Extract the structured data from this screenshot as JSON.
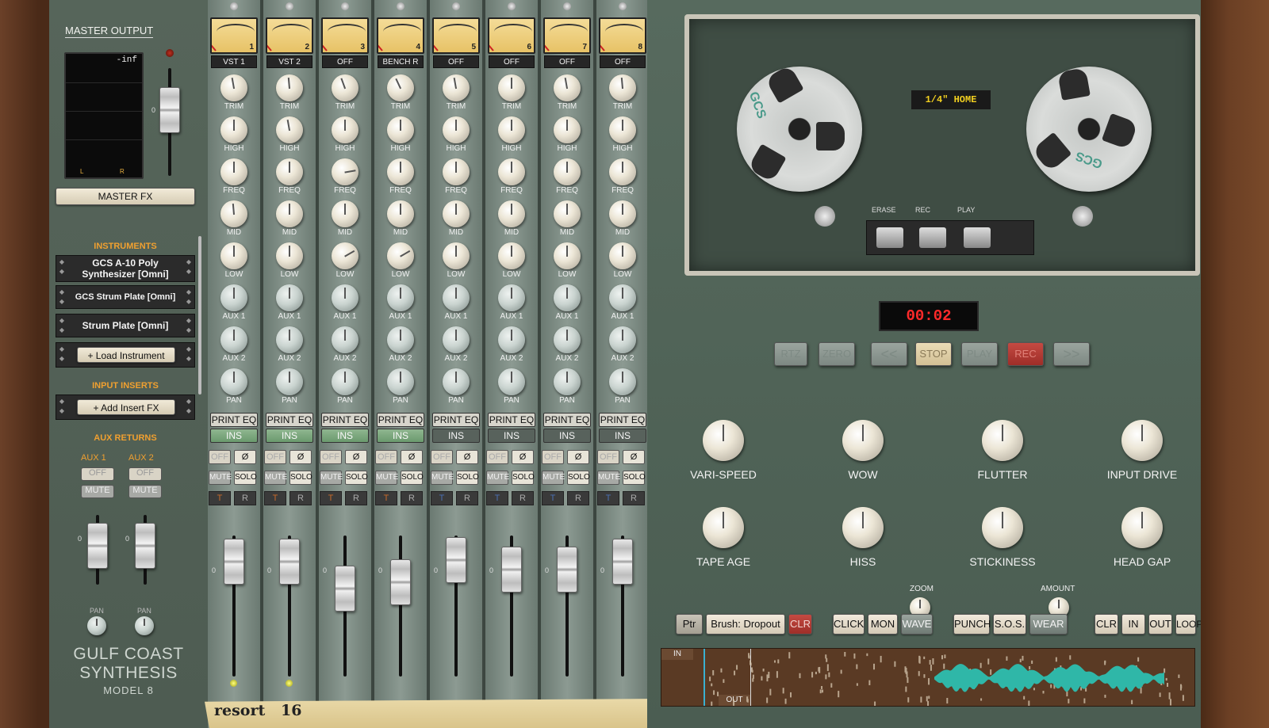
{
  "master": {
    "title": "MASTER OUTPUT",
    "meter_value": "-inf",
    "meter_l": "L",
    "meter_r": "R",
    "zero": "0",
    "fx_label": "MASTER FX"
  },
  "instruments": {
    "heading": "INSTRUMENTS",
    "slots": [
      "GCS A-10 Poly Synthesizer [Omni]",
      "GCS Strum Plate [Omni]",
      "Strum Plate [Omni]"
    ],
    "load_label": "+ Load Instrument"
  },
  "inserts": {
    "heading": "INPUT INSERTS",
    "add_label": "+ Add Insert FX"
  },
  "aux_returns": {
    "heading": "AUX RETURNS",
    "aux1": "AUX 1",
    "aux2": "AUX 2",
    "off": "OFF",
    "mute": "MUTE",
    "pan": "PAN",
    "zero": "0"
  },
  "brand": {
    "line1": "GULF COAST",
    "line2": "SYNTHESIS",
    "line3": "MODEL 8"
  },
  "channel_labels": {
    "trim": "TRIM",
    "high": "HIGH",
    "freq": "FREQ",
    "mid": "MID",
    "low": "LOW",
    "aux1": "AUX 1",
    "aux2": "AUX 2",
    "pan": "PAN",
    "print_eq": "PRINT EQ",
    "ins": "INS",
    "off": "OFF",
    "phase": "Ø",
    "mute": "MUTE",
    "solo": "SOLO",
    "t": "T",
    "r": "R",
    "zero": "0"
  },
  "channels": [
    {
      "num": "1",
      "route": "VST 1",
      "ins_on": true
    },
    {
      "num": "2",
      "route": "VST 2",
      "ins_on": true
    },
    {
      "num": "3",
      "route": "OFF",
      "ins_on": true
    },
    {
      "num": "4",
      "route": "BENCH R",
      "ins_on": true
    },
    {
      "num": "5",
      "route": "OFF",
      "ins_on": false
    },
    {
      "num": "6",
      "route": "OFF",
      "ins_on": false
    },
    {
      "num": "7",
      "route": "OFF",
      "ins_on": false
    },
    {
      "num": "8",
      "route": "OFF",
      "ins_on": false
    }
  ],
  "strip": {
    "name": "resort",
    "tempo": "16"
  },
  "deck": {
    "tape_label": "1/4\" HOME",
    "erase": "ERASE",
    "rec": "REC",
    "play": "PLAY",
    "reel_text": "GCS"
  },
  "transport": {
    "timer": "00:02",
    "rtz": "RTZ",
    "zero": "ZERO",
    "rew": "<<",
    "stop": "STOP",
    "play": "PLAY",
    "rec": "REC",
    "ffwd": ">>"
  },
  "tape_knobs": {
    "varispeed": "VARI-SPEED",
    "wow": "WOW",
    "flutter": "FLUTTER",
    "input_drive": "INPUT DRIVE",
    "tape_age": "TAPE AGE",
    "hiss": "HISS",
    "stickiness": "STICKINESS",
    "head_gap": "HEAD GAP",
    "zoom": "ZOOM",
    "amount": "AMOUNT"
  },
  "bottom_bar": {
    "ptr": "Ptr",
    "brush": "Brush: Dropout",
    "clr": "CLR",
    "click": "CLICK",
    "mon": "MON",
    "wave": "WAVE",
    "punch": "PUNCH",
    "sos": "S.O.S.",
    "wear": "WEAR",
    "clr2": "CLR",
    "in": "IN",
    "out": "OUT",
    "loop": "LOOP"
  },
  "waveform": {
    "in": "IN",
    "out": "OUT"
  },
  "colors": {
    "accent_orange": "#f0a030",
    "rec_red": "#c0302a",
    "timer_red": "#ff2a2a",
    "wave_teal": "#2fb7a8",
    "vu_amber": "#e7c266"
  }
}
